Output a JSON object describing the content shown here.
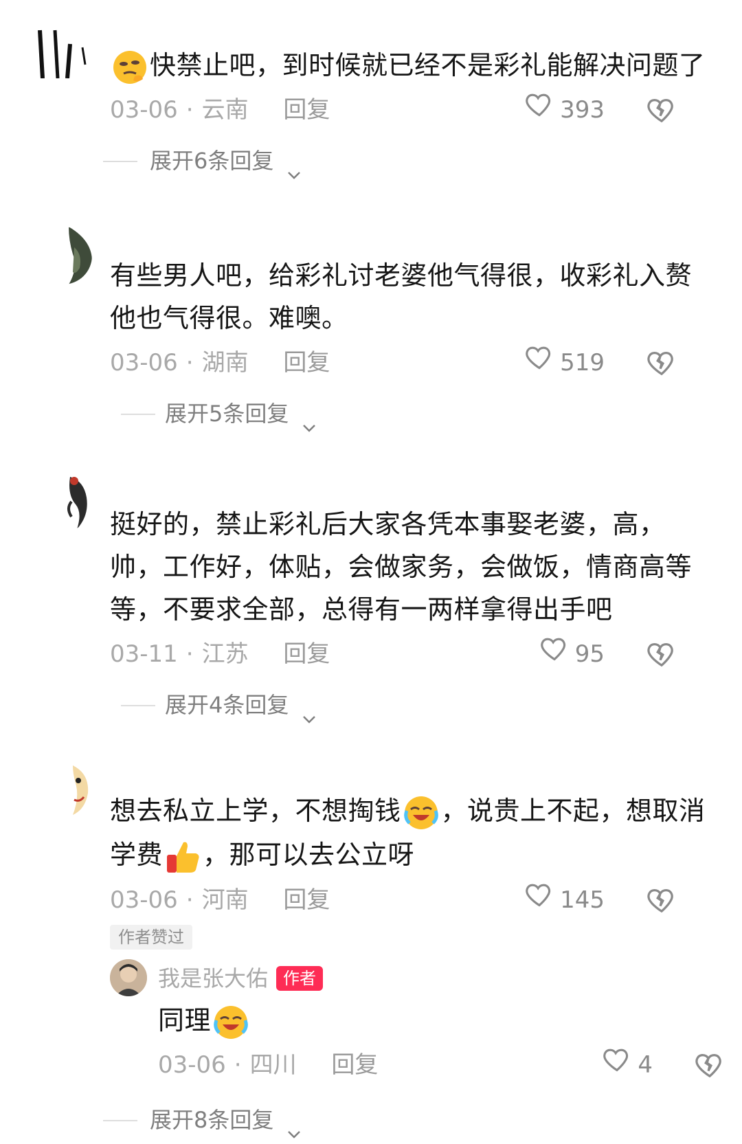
{
  "comments": [
    {
      "username": "",
      "text_parts": [
        "快禁止吧，到时候就已经不是彩礼能解决问题了"
      ],
      "leading_emoji": "thinking-face-emoji",
      "date": "03-06",
      "sep": "·",
      "location": "云南",
      "reply_label": "回复",
      "likes": "393",
      "expand_label": "展开6条回复"
    },
    {
      "username": "",
      "text": "有些男人吧，给彩礼讨老婆他气得很，收彩礼入赘他也气得很。难噢。",
      "date": "03-06",
      "sep": "·",
      "location": "湖南",
      "reply_label": "回复",
      "likes": "519",
      "expand_label": "展开5条回复"
    },
    {
      "username": "",
      "text": "挺好的，禁止彩礼后大家各凭本事娶老婆，高，帅，工作好，体贴，会做家务，会做饭，情商高等等，不要求全部，总得有一两样拿得出手吧",
      "date": "03-11",
      "sep": "·",
      "location": "江苏",
      "reply_label": "回复",
      "likes": "95",
      "expand_label": "展开4条回复"
    },
    {
      "username": "",
      "text_a": "想去私立上学，不想掏钱",
      "emoji_a": "crying-laughing-emoji",
      "text_b": "，说贵上不起，想取消学费",
      "emoji_b": "thumbs-up-emoji",
      "text_c": "，那可以去公立呀",
      "date": "03-06",
      "sep": "·",
      "location": "河南",
      "reply_label": "回复",
      "likes": "145",
      "author_liked": "作者赞过"
    }
  ],
  "author_reply": {
    "username": "我是张大佑",
    "badge": "作者",
    "text": "同理",
    "emoji": "crying-laughing-emoji",
    "date": "03-06",
    "sep": "·",
    "location": "四川",
    "reply_label": "回复",
    "likes": "4",
    "expand_label": "展开8条回复"
  },
  "colors": {
    "text": "#161616",
    "meta": "#a8a8a8",
    "author_badge": "#fe2c55",
    "author_liked_bg": "#f1f1f1"
  }
}
